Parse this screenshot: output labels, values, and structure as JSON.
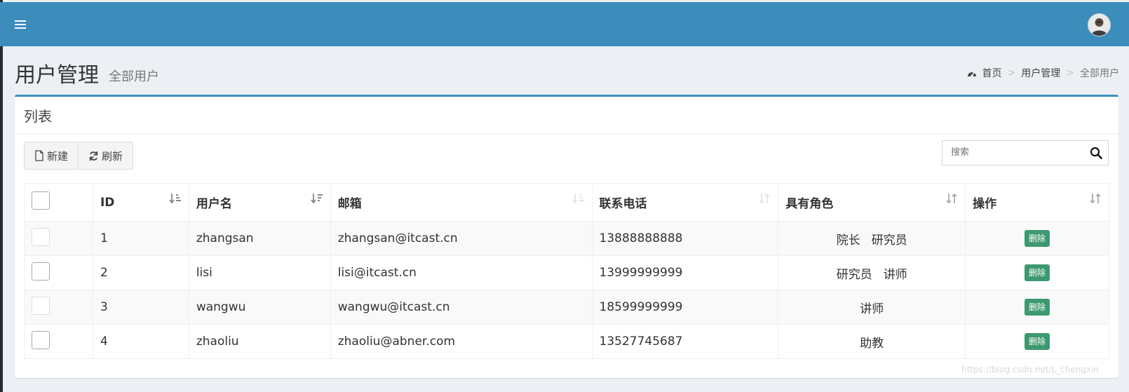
{
  "header": {
    "menu_icon": "hamburger-icon",
    "avatar_icon": "user-avatar"
  },
  "page": {
    "title": "用户管理",
    "subtitle": "全部用户"
  },
  "breadcrumb": {
    "icon": "dashboard-icon",
    "items": [
      "首页",
      "用户管理",
      "全部用户"
    ],
    "separator": ">"
  },
  "box": {
    "title": "列表"
  },
  "toolbar": {
    "new_label": "新建",
    "refresh_label": "刷新"
  },
  "search": {
    "placeholder": "搜索"
  },
  "table": {
    "columns": [
      "ID",
      "用户名",
      "邮箱",
      "联系电话",
      "具有角色",
      "操作"
    ],
    "rows": [
      {
        "id": "1",
        "username": "zhangsan",
        "email": "zhangsan@itcast.cn",
        "phone": "13888888888",
        "roles": [
          "院长",
          "研究员"
        ]
      },
      {
        "id": "2",
        "username": "lisi",
        "email": "lisi@itcast.cn",
        "phone": "13999999999",
        "roles": [
          "研究员",
          "讲师"
        ]
      },
      {
        "id": "3",
        "username": "wangwu",
        "email": "wangwu@itcast.cn",
        "phone": "18599999999",
        "roles": [
          "讲师"
        ]
      },
      {
        "id": "4",
        "username": "zhaoliu",
        "email": "zhaoliu@abner.com",
        "phone": "13527745687",
        "roles": [
          "助教"
        ]
      }
    ],
    "delete_label": "删除"
  },
  "watermark": "https://blog.csdn.net/L_chengxin",
  "colors": {
    "header": "#3c8dbc",
    "delete_button": "#3d9970",
    "background": "#ecf0f5"
  }
}
